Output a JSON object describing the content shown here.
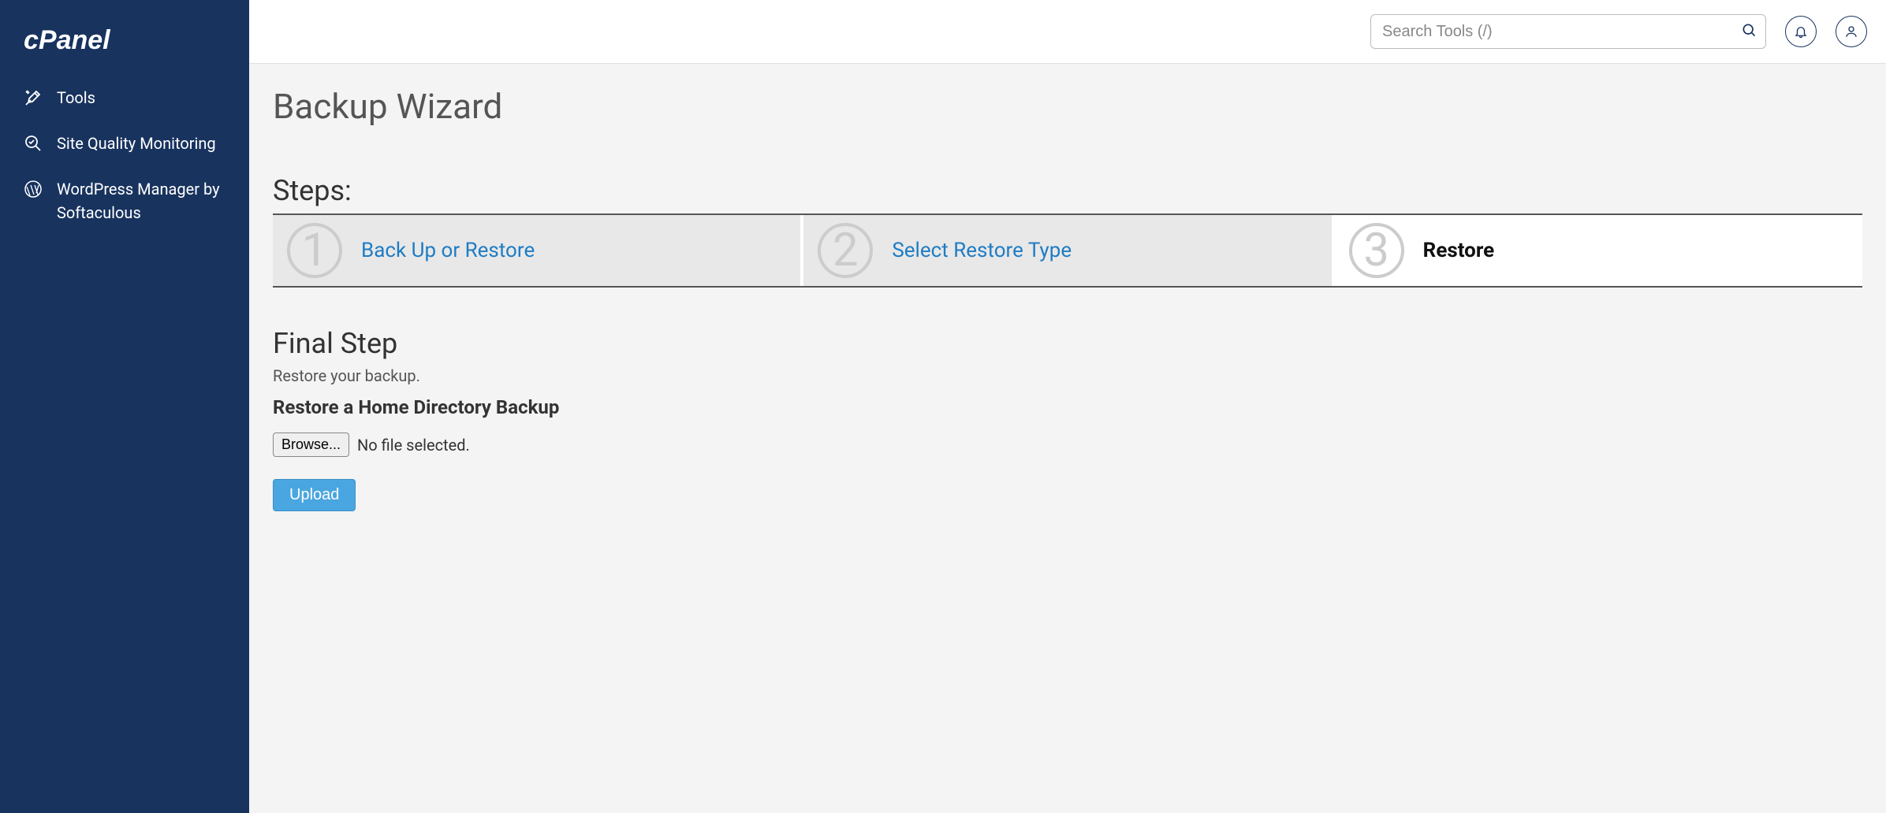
{
  "brand": "cPanel",
  "sidebar": {
    "items": [
      {
        "label": "Tools"
      },
      {
        "label": "Site Quality Monitoring"
      },
      {
        "label": "WordPress Manager by Softaculous"
      }
    ]
  },
  "search": {
    "placeholder": "Search Tools (/)"
  },
  "page": {
    "title": "Backup Wizard",
    "steps_label": "Steps:",
    "steps": [
      {
        "num": "1",
        "label": "Back Up or Restore"
      },
      {
        "num": "2",
        "label": "Select Restore Type"
      },
      {
        "num": "3",
        "label": "Restore"
      }
    ],
    "final_heading": "Final Step",
    "final_sub": "Restore your backup.",
    "restore_heading": "Restore a Home Directory Backup",
    "browse_label": "Browse...",
    "file_status": "No file selected.",
    "upload_label": "Upload"
  }
}
